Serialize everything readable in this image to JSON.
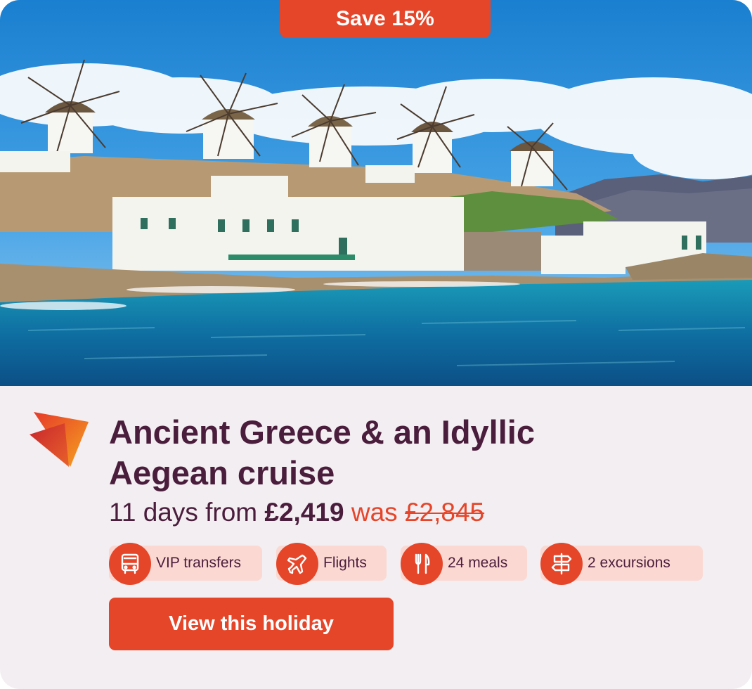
{
  "badge": {
    "text": "Save 15%"
  },
  "hero": {
    "image": "Mykonos windmills above whitewashed waterfront village and turquoise sea"
  },
  "holiday": {
    "title": "Ancient Greece & an Idyllic Aegean cruise",
    "duration_text": "11 days from",
    "price": "£2,419",
    "was_label": "was",
    "was_price": "£2,845"
  },
  "features": [
    {
      "label": "VIP transfers",
      "icon": "bus-icon"
    },
    {
      "label": "Flights",
      "icon": "airplane-icon"
    },
    {
      "label": "24 meals",
      "icon": "fork-knife-icon"
    },
    {
      "label": "2 excursions",
      "icon": "signpost-icon"
    }
  ],
  "cta": {
    "label": "View this holiday"
  },
  "colors": {
    "accent": "#e5462a",
    "title": "#4a1d3c",
    "panel": "#f3eef2",
    "chip": "#fbd9d2"
  }
}
